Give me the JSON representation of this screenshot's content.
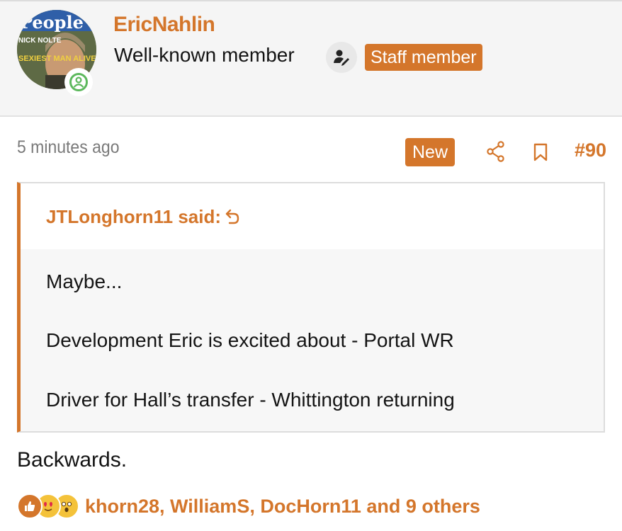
{
  "user": {
    "name": "EricNahlin",
    "title": "Well-known member",
    "staff_badge": "Staff member",
    "avatar_text": "People",
    "avatar_text_2": "NICK NOLTE",
    "avatar_text_3": "SEXIEST MAN ALIVE",
    "online_icon": "user-circle-icon",
    "pen_icon": "user-pen-icon"
  },
  "post": {
    "time": "5 minutes ago",
    "new_badge": "New",
    "share_icon": "share-icon",
    "bookmark_icon": "bookmark-icon",
    "number": "#90"
  },
  "quote": {
    "author": "JTLonghorn11 said:",
    "jump_icon": "jump-to-quote-icon",
    "lines": [
      "Maybe...",
      "Development Eric is excited about - Portal WR",
      "Driver for Hall’s transfer - Whittington returning"
    ]
  },
  "reply": "Backwards.",
  "reactions": {
    "icons": [
      "like-icon",
      "love-icon",
      "wow-icon"
    ],
    "text": "khorn28, WilliamS, DocHorn11 and 9 others"
  },
  "colors": {
    "accent": "#d4762b",
    "online": "#5cb85c",
    "muted": "#7a7a7a"
  }
}
